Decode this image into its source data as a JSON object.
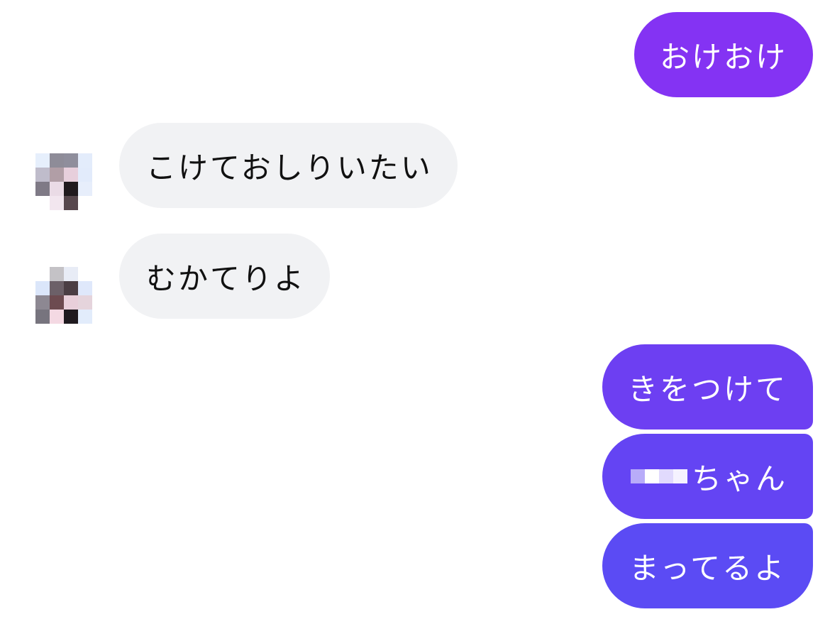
{
  "messages": [
    {
      "id": "msg-1",
      "direction": "sent",
      "text": "おけおけ"
    },
    {
      "id": "msg-2",
      "direction": "received",
      "text": "こけておしりいたい"
    },
    {
      "id": "msg-3",
      "direction": "received",
      "text": "むかてりよ"
    },
    {
      "id": "msg-4",
      "direction": "sent",
      "text": "きをつけて"
    },
    {
      "id": "msg-5",
      "direction": "sent",
      "text": "ちゃん",
      "redacted_prefix": true
    },
    {
      "id": "msg-6",
      "direction": "sent",
      "text": "まってるよ"
    }
  ],
  "colors": {
    "sent_bubble_top": "#8433f3",
    "sent_bubble_bottom": "#5b4bf4",
    "received_bubble": "#f1f2f4",
    "received_text": "#111111",
    "sent_text": "#ffffff"
  },
  "avatars": [
    {
      "icon": "pixelated-avatar-icon",
      "message": "msg-2"
    },
    {
      "icon": "pixelated-avatar-icon",
      "message": "msg-3"
    }
  ]
}
